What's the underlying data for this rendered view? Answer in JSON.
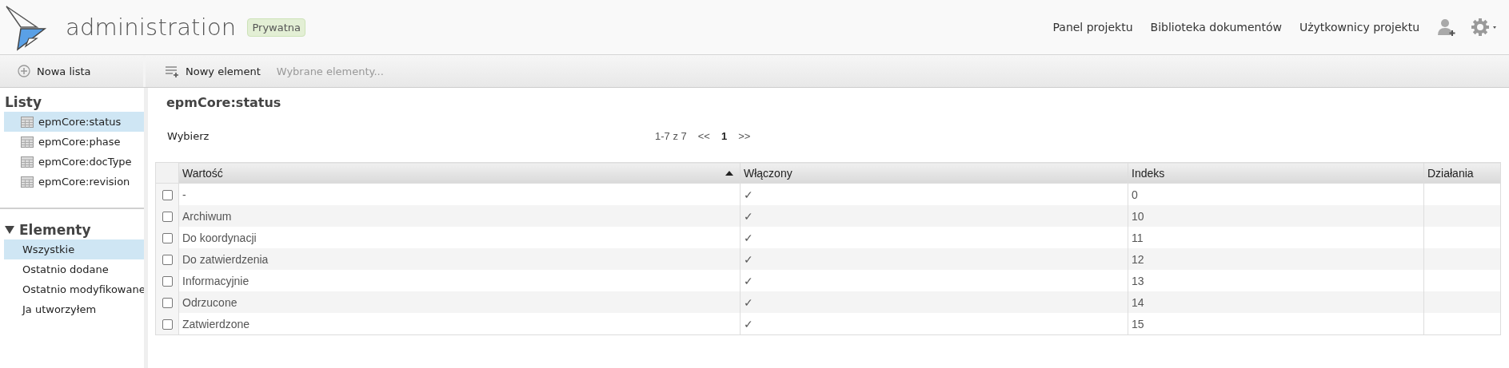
{
  "header": {
    "title": "administration",
    "badge": "Prywatna",
    "nav": [
      {
        "label": "Panel projektu"
      },
      {
        "label": "Biblioteka dokumentów"
      },
      {
        "label": "Użytkownicy projektu"
      }
    ]
  },
  "toolbar": {
    "new_list": "Nowa lista",
    "new_element": "Nowy element",
    "selected_items": {
      "label": "Wybrane elementy...",
      "disabled": true
    }
  },
  "sidebar": {
    "lists_title": "Listy",
    "lists": [
      {
        "label": "epmCore:status",
        "selected": true
      },
      {
        "label": "epmCore:phase",
        "selected": false
      },
      {
        "label": "epmCore:docType",
        "selected": false
      },
      {
        "label": "epmCore:revision",
        "selected": false
      }
    ],
    "elements_title": "Elementy",
    "elements_expanded": true,
    "filters": [
      {
        "label": "Wszystkie",
        "selected": true
      },
      {
        "label": "Ostatnio dodane",
        "selected": false
      },
      {
        "label": "Ostatnio modyfikowane",
        "selected": false
      },
      {
        "label": "Ja utworzyłem",
        "selected": false
      }
    ]
  },
  "content": {
    "title": "epmCore:status",
    "select_label": "Wybierz",
    "pager": {
      "range": "1-7 z 7",
      "prev": "<<",
      "page": "1",
      "next": ">>"
    },
    "table": {
      "columns": [
        {
          "label": "Wartość",
          "sorted": true
        },
        {
          "label": "Włączony",
          "sorted": false
        },
        {
          "label": "Indeks",
          "sorted": false
        },
        {
          "label": "Działania",
          "sorted": false
        }
      ],
      "rows": [
        {
          "checked": false,
          "value": "-",
          "enabled": "✓",
          "index": "0"
        },
        {
          "checked": false,
          "value": "Archiwum",
          "enabled": "✓",
          "index": "10"
        },
        {
          "checked": false,
          "value": "Do koordynacji",
          "enabled": "✓",
          "index": "11"
        },
        {
          "checked": false,
          "value": "Do zatwierdzenia",
          "enabled": "✓",
          "index": "12"
        },
        {
          "checked": false,
          "value": "Informacyjnie",
          "enabled": "✓",
          "index": "13"
        },
        {
          "checked": false,
          "value": "Odrzucone",
          "enabled": "✓",
          "index": "14"
        },
        {
          "checked": false,
          "value": "Zatwierdzone",
          "enabled": "✓",
          "index": "15"
        }
      ]
    }
  }
}
